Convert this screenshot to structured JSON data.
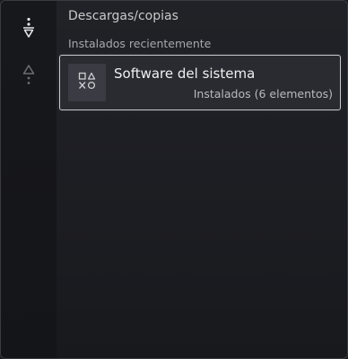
{
  "rail": {
    "items": [
      {
        "icon": "sort-filter-down-icon",
        "active": true
      },
      {
        "icon": "triangle-dots-icon",
        "active": false
      }
    ]
  },
  "main": {
    "section_title": "Descargas/copias",
    "group_label": "Instalados recientemente",
    "items": [
      {
        "icon": "playstation-shapes-icon",
        "title": "Software del sistema",
        "subtitle": "Instalados (6 elementos)"
      }
    ]
  },
  "colors": {
    "background": "#1c1d22",
    "rail": "#16171b",
    "card_border": "#c9cacf",
    "card_background": "#2a2b31"
  }
}
